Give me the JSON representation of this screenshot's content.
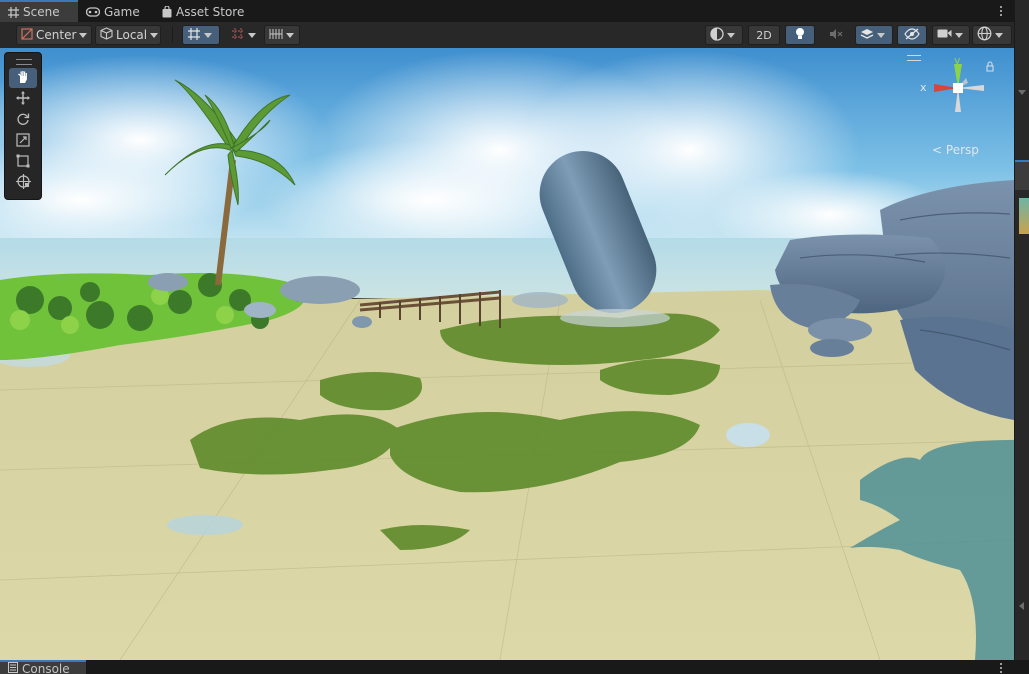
{
  "tabs": [
    {
      "label": "Scene",
      "icon": "hash-grid-icon",
      "active": true
    },
    {
      "label": "Game",
      "icon": "gamepad-icon",
      "active": false
    },
    {
      "label": "Asset Store",
      "icon": "shopping-bag-icon",
      "active": false
    }
  ],
  "toolbar": {
    "pivot_mode": "Center",
    "pivot_rotation": "Local",
    "mode_2d": "2D"
  },
  "gizmo": {
    "y_label": "y",
    "x_label": "x",
    "projection": "Persp"
  },
  "bottom": {
    "console_label": "Console"
  },
  "colors": {
    "accent": "#3a79bb",
    "selected_button": "#46607c",
    "panel": "#282828",
    "tab_active": "#3c3c3c"
  }
}
